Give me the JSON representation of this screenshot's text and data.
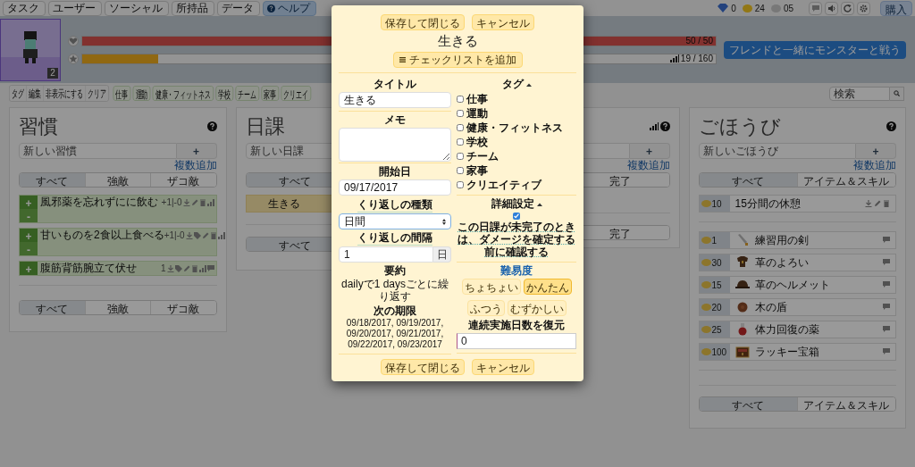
{
  "nav": {
    "items": [
      {
        "label": "タスク",
        "kind": "menu"
      },
      {
        "label": "ユーザー",
        "kind": "menu"
      },
      {
        "label": "ソーシャル",
        "kind": "menu"
      },
      {
        "label": "所持品",
        "kind": "menu"
      },
      {
        "label": "データ",
        "kind": "menu"
      },
      {
        "label": "ヘルプ",
        "kind": "help"
      }
    ],
    "gems": "0",
    "gold": "24",
    "silver": "05",
    "buy_button": "購入"
  },
  "header": {
    "level_badge": "2",
    "hp": {
      "level": 1,
      "reading": "50 / 50"
    },
    "xp": {
      "level": 0.12,
      "reading": "19 / 160"
    },
    "party_button": "フレンドと一緒にモンスターと戦う"
  },
  "filters": {
    "actions": [
      "タグ",
      "編集",
      "非表示にする",
      "クリア"
    ],
    "tags": [
      "仕事",
      "運動",
      "健康・フィットネス",
      "学校",
      "チーム",
      "家事",
      "クリエイ"
    ],
    "search": {
      "placeholder": "検索"
    }
  },
  "habits": {
    "title": "習慣",
    "placeholder": "新しい習慣",
    "add": "+",
    "bulk_add": "複数追加",
    "tabs": [
      {
        "label": "すべて",
        "selected": true
      },
      {
        "label": "強敵",
        "selected": false
      },
      {
        "label": "ザコ敵",
        "selected": false
      }
    ],
    "items": [
      {
        "text": "風邪薬を忘れずにに飲む",
        "score": "+1|-0",
        "up": "+",
        "down": "-",
        "tagged": false,
        "noted": false
      },
      {
        "text": "甘いものを2食以上食べる",
        "score": "+1|-0",
        "up": "+",
        "down": "-",
        "tagged": true,
        "noted": false
      },
      {
        "text": "腹筋背筋腕立て伏せ",
        "score": "1",
        "up": "+",
        "tagged": true,
        "noted": true
      }
    ],
    "bottom_tabs": [
      {
        "label": "すべて",
        "selected": true
      },
      {
        "label": "強敵",
        "selected": false
      },
      {
        "label": "ザコ敵",
        "selected": false
      }
    ]
  },
  "dailies": {
    "title": "日課",
    "placeholder": "新しい日課",
    "tabs": [
      {
        "label": "すべて",
        "selected": true
      }
    ],
    "items": [
      {
        "text": "生きる"
      }
    ],
    "bottom_tabs": [
      {
        "label": "すべて",
        "selected": true
      }
    ]
  },
  "todos": {
    "add": "+",
    "bulk_add": "複数追加",
    "tabs": [
      {
        "label": "完了",
        "selected": false
      }
    ],
    "bottom_tabs": [
      {
        "label": "完了",
        "selected": false
      }
    ]
  },
  "rewards": {
    "title": "ごほうび",
    "placeholder": "新しいごほうび",
    "add": "+",
    "bulk_add": "複数追加",
    "tabs": [
      {
        "label": "すべて",
        "selected": true
      },
      {
        "label": "アイテム＆スキル",
        "selected": false
      }
    ],
    "custom": [
      {
        "price": "10",
        "text": "15分間の休憩"
      }
    ],
    "items": [
      {
        "price": "1",
        "text": "練習用の剣",
        "kind": "sword"
      },
      {
        "price": "30",
        "text": "革のよろい",
        "kind": "armor"
      },
      {
        "price": "15",
        "text": "革のヘルメット",
        "kind": "helmet"
      },
      {
        "price": "20",
        "text": "木の盾",
        "kind": "shield"
      },
      {
        "price": "25",
        "text": "体力回復の薬",
        "kind": "potion"
      },
      {
        "price": "100",
        "text": "ラッキー宝箱",
        "kind": "chest"
      }
    ],
    "bottom_tabs": [
      {
        "label": "すべて",
        "selected": true
      },
      {
        "label": "アイテム＆スキル",
        "selected": false
      }
    ]
  },
  "modal": {
    "buttons": [
      "保存して閉じる",
      "キャンセル"
    ],
    "title": "生きる",
    "checklist_button": "チェックリストを追加",
    "title_label": "タイトル",
    "title_value": "生きる",
    "notes_label": "メモ",
    "start_label": "開始日",
    "start_value": "09/17/2017",
    "repeat_label": "くり返しの種類",
    "repeat_value": "日間",
    "interval_label": "くり返しの間隔",
    "interval_value": "1",
    "interval_unit": "日",
    "summary_label": "要約",
    "summary": "dailyで1 daysごとに繰り返す",
    "next_label": "次の期限",
    "next_dates": "09/18/2017, 09/19/2017, 09/20/2017, 09/21/2017, 09/22/2017, 09/23/2017",
    "tags_label": "タグ",
    "tags": [
      {
        "label": "仕事",
        "checked": false
      },
      {
        "label": "運動",
        "checked": false
      },
      {
        "label": "健康・フィットネス",
        "checked": false
      },
      {
        "label": "学校",
        "checked": false
      },
      {
        "label": "チーム",
        "checked": false
      },
      {
        "label": "家事",
        "checked": false
      },
      {
        "label": "クリエイティブ",
        "checked": false
      }
    ],
    "advanced_label": "詳細設定",
    "confirm_checked": true,
    "confirm_text": "この日課が未完了のときは、ダメージを確定する前に確認する",
    "difficulty_label": "難易度",
    "difficulties": [
      {
        "label": "ちょちょい",
        "selected": false
      },
      {
        "label": "かんたん",
        "selected": true
      },
      {
        "label": "ふつう",
        "selected": false
      },
      {
        "label": "むずかしい",
        "selected": false
      }
    ],
    "streak_label": "連続実施日数を復元",
    "streak_value": "0",
    "bottom_buttons": [
      "保存して閉じる",
      "キャンセル"
    ]
  }
}
